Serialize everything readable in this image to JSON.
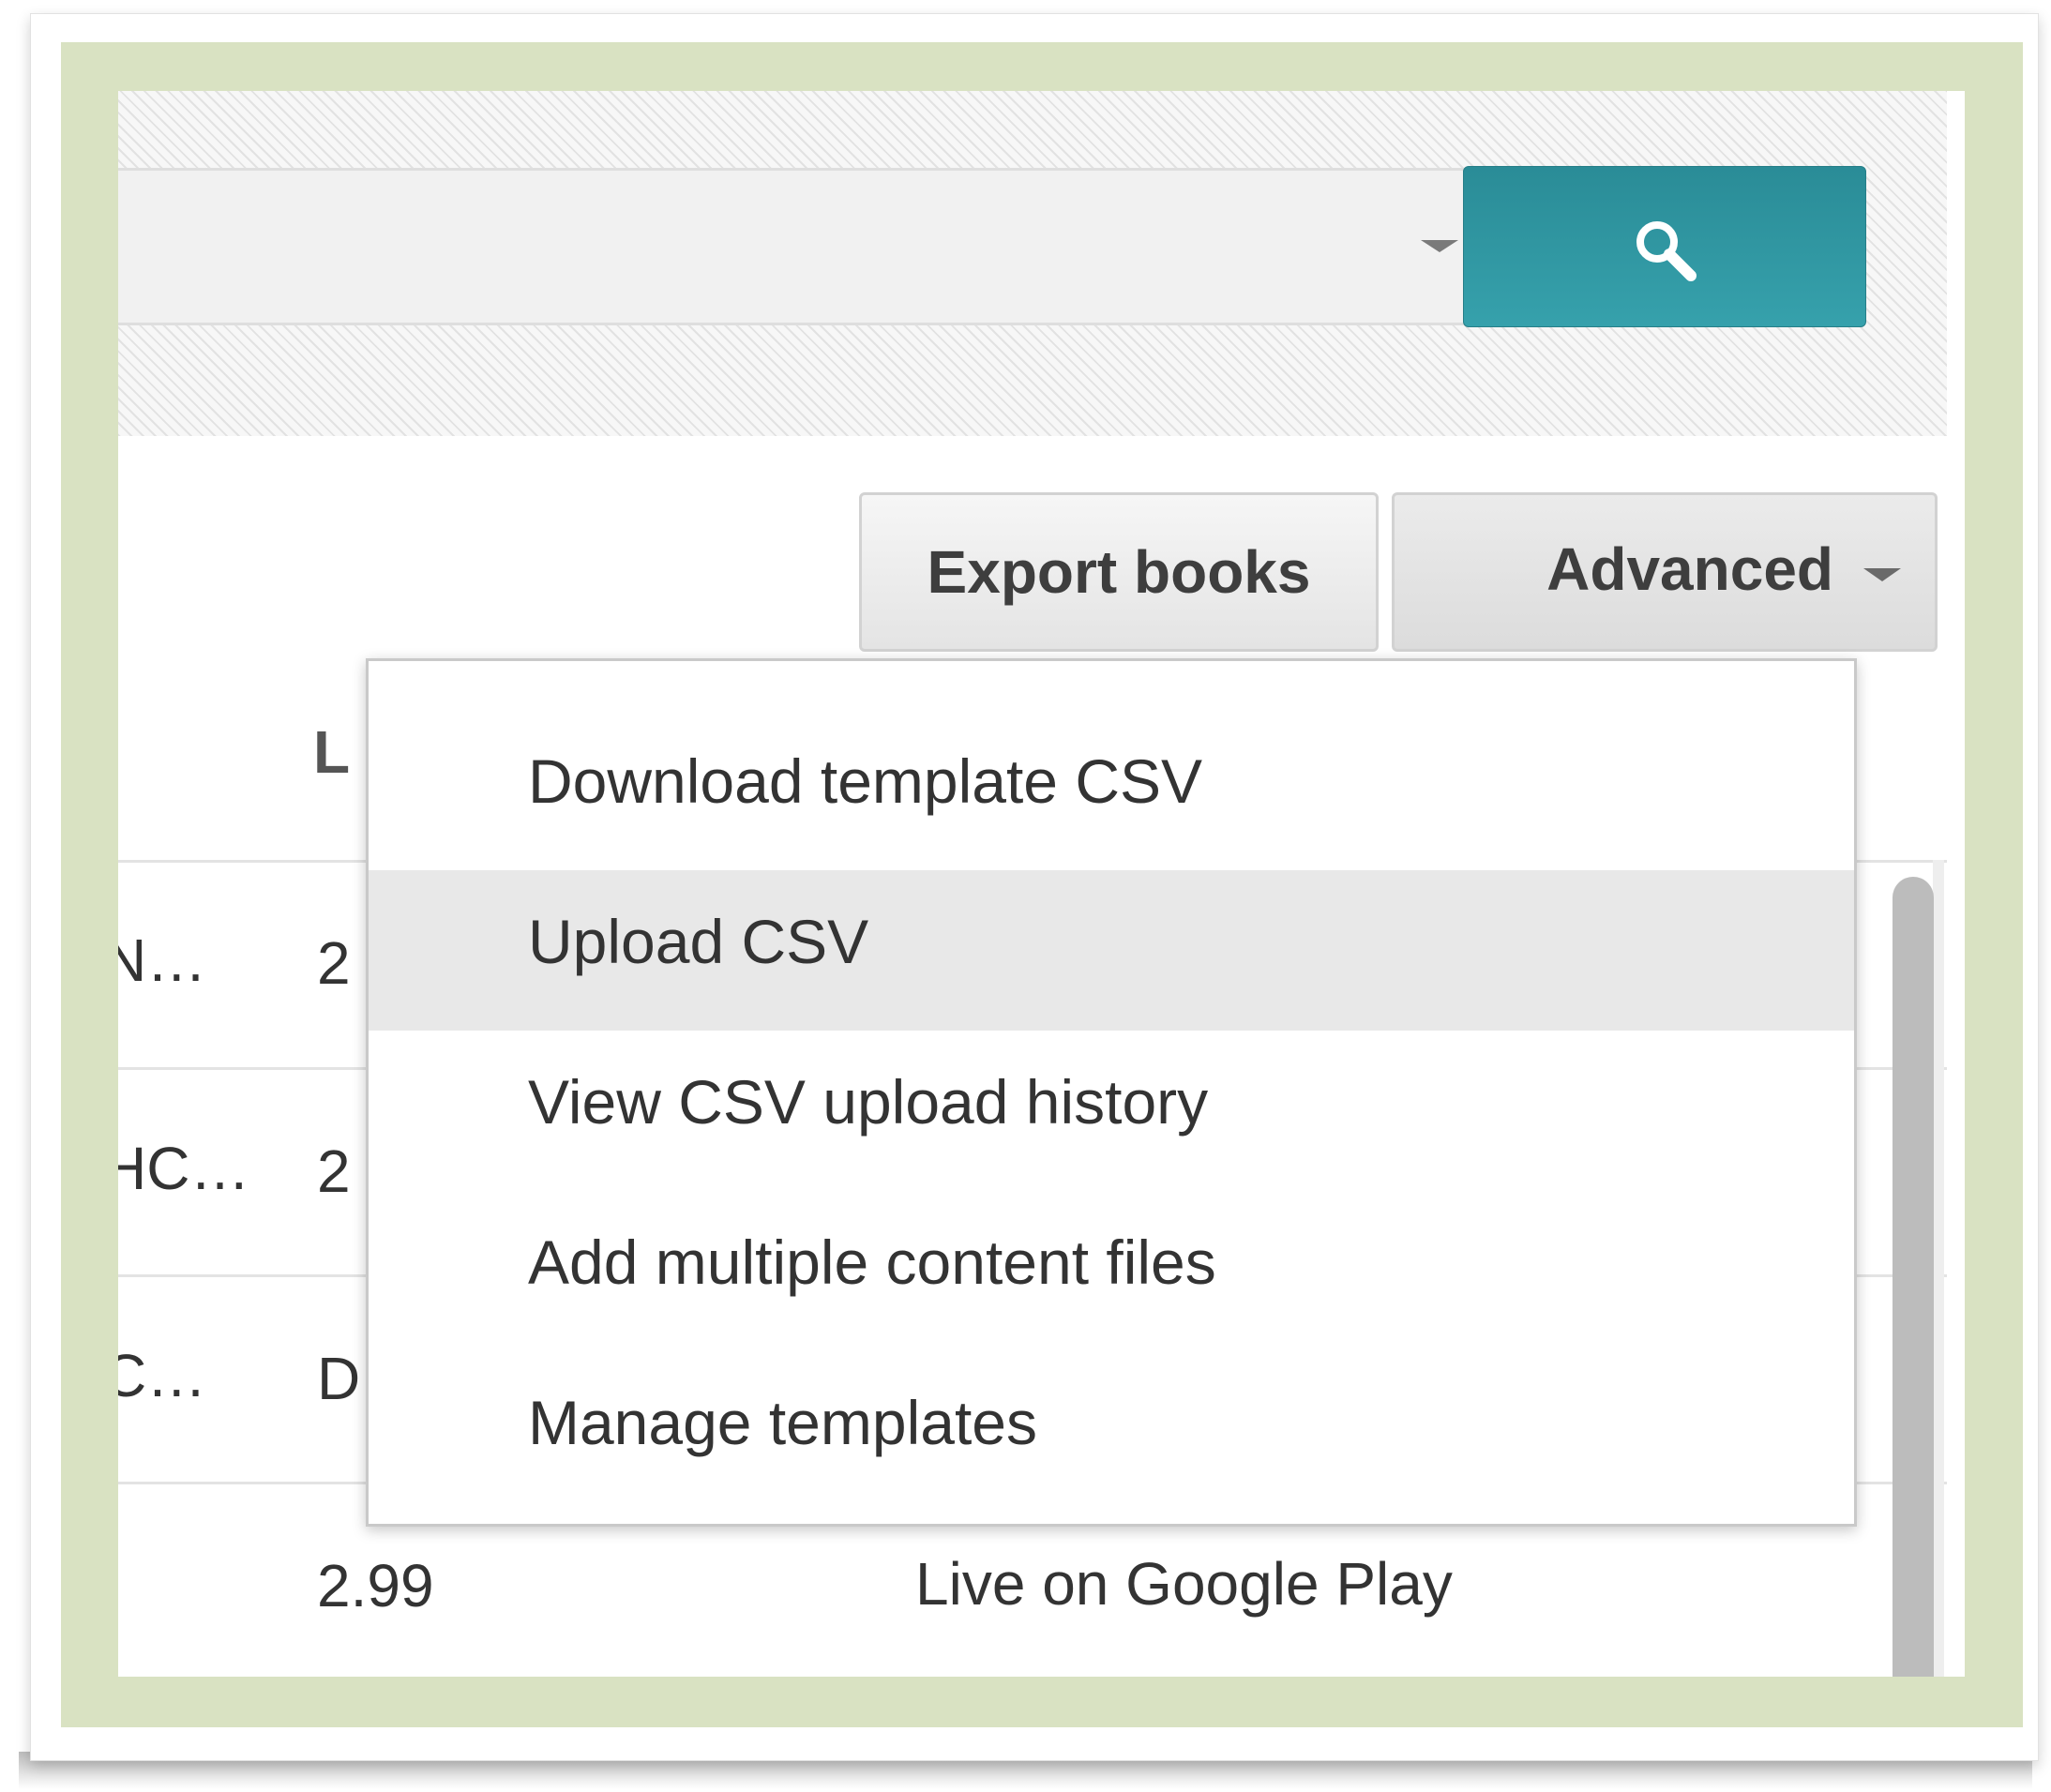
{
  "search": {
    "select_value": "",
    "button_icon": "search-icon"
  },
  "toolbar": {
    "export_label": "Export books",
    "advanced_label": "Advanced"
  },
  "table": {
    "header_fragment": "L",
    "rows": [
      {
        "left": "N…",
        "price": "2"
      },
      {
        "left": "HC…",
        "price": "2"
      },
      {
        "left": "C…",
        "price": "D"
      },
      {
        "left": "",
        "price": "2.99",
        "status": "Live on Google Play"
      }
    ]
  },
  "advanced_menu": {
    "items": [
      {
        "label": "Download template CSV"
      },
      {
        "label": "Upload CSV",
        "highlighted": true
      },
      {
        "label": "View CSV upload history"
      },
      {
        "label": "Add multiple content files"
      },
      {
        "label": "Manage templates"
      }
    ]
  },
  "colors": {
    "frame": "#d9e2c2",
    "search_button": "#2f96a1",
    "menu_highlight": "#e8e8e8"
  }
}
